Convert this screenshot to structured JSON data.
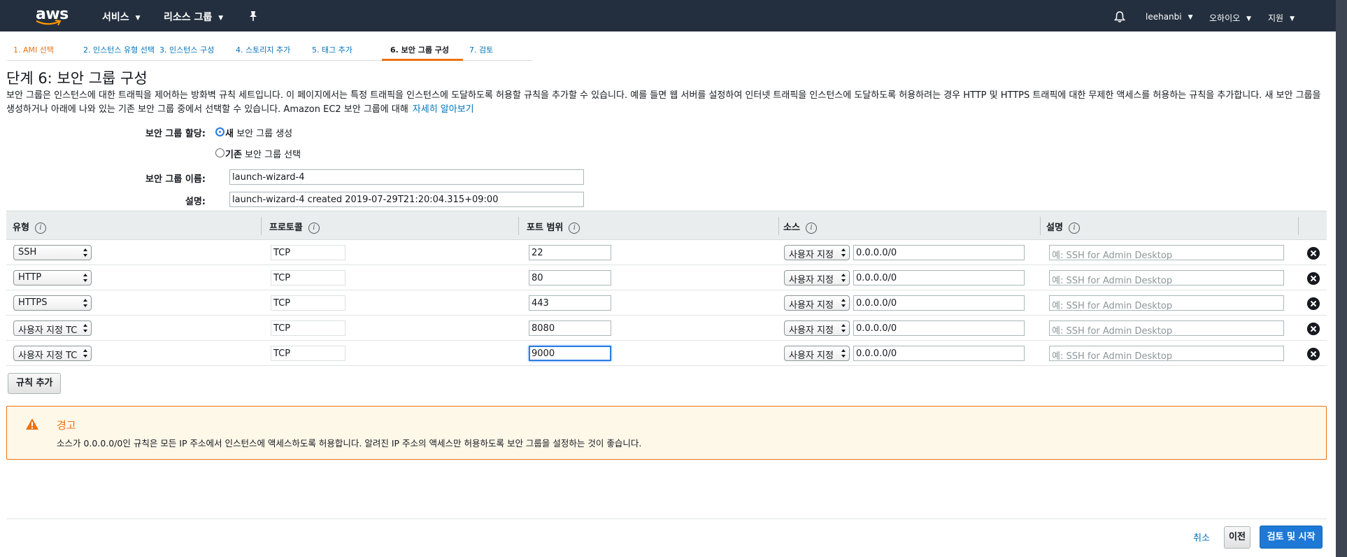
{
  "colors": {
    "nav_bg": "#232f3e",
    "accent": "#ec7211",
    "link": "#0073bb",
    "primary_button": "#1e79d6"
  },
  "topnav": {
    "logo": "aws",
    "services": "서비스",
    "resource_groups": "리소스 그룹",
    "pin_icon": "pin-icon",
    "bell_icon": "bell-icon",
    "user": "leehanbi",
    "region": "오하이오",
    "support": "지원"
  },
  "tabs": [
    {
      "label": "1. AMI 선택",
      "state": "done"
    },
    {
      "label": "2. 인스턴스 유형 선택",
      "state": "link"
    },
    {
      "label": "3. 인스턴스 구성",
      "state": "link"
    },
    {
      "label": "4. 스토리지 추가",
      "state": "link"
    },
    {
      "label": "5. 태그 추가",
      "state": "link"
    },
    {
      "label": "6. 보안 그룹 구성",
      "state": "active"
    },
    {
      "label": "7. 검토",
      "state": "link"
    }
  ],
  "page": {
    "title": "단계 6: 보안 그룹 구성",
    "intro": "보안 그룹은 인스턴스에 대한 트래픽을 제어하는 방화벽 규칙 세트입니다. 이 페이지에서는 특정 트래픽을 인스턴스에 도달하도록 허용할 규칙을 추가할 수 있습니다. 예를 들면 웹 서버를 설정하여 인터넷 트래픽을 인스턴스에 도달하도록 허용하려는 경우 HTTP 및 HTTPS 트래픽에 대한 무제한 액세스를 허용하는 규칙을 추가합니다. 새 보안 그룹을 생성하거나 아래에 나와 있는 기존 보안 그룹 중에서 선택할 수 있습니다. Amazon EC2 보안 그룹에 대해",
    "learn_more": "자세히 알아보기"
  },
  "form": {
    "assign_label": "보안 그룹 할당:",
    "option_new_bold": "새",
    "option_new_rest": " 보안 그룹 생성",
    "option_existing_bold": "기존",
    "option_existing_rest": " 보안 그룹 선택",
    "name_label": "보안 그룹 이름:",
    "name_value": "launch-wizard-4",
    "desc_label": "설명:",
    "desc_value": "launch-wizard-4 created 2019-07-29T21:20:04.315+09:00"
  },
  "table": {
    "headers": {
      "type": "유형",
      "protocol": "프로토콜",
      "port": "포트 범위",
      "source": "소스",
      "description": "설명"
    },
    "rows": [
      {
        "type": "SSH",
        "protocol": "TCP",
        "port": "22",
        "source_type": "사용자 지정",
        "source": "0.0.0.0/0",
        "desc_placeholder": "예: SSH for Admin Desktop"
      },
      {
        "type": "HTTP",
        "protocol": "TCP",
        "port": "80",
        "source_type": "사용자 지정",
        "source": "0.0.0.0/0",
        "desc_placeholder": "예: SSH for Admin Desktop"
      },
      {
        "type": "HTTPS",
        "protocol": "TCP",
        "port": "443",
        "source_type": "사용자 지정",
        "source": "0.0.0.0/0",
        "desc_placeholder": "예: SSH for Admin Desktop"
      },
      {
        "type": "사용자 지정 TC",
        "protocol": "TCP",
        "port": "8080",
        "source_type": "사용자 지정",
        "source": "0.0.0.0/0",
        "desc_placeholder": "예: SSH for Admin Desktop"
      },
      {
        "type": "사용자 지정 TC",
        "protocol": "TCP",
        "port": "9000",
        "source_type": "사용자 지정",
        "source": "0.0.0.0/0",
        "desc_placeholder": "예: SSH for Admin Desktop"
      }
    ],
    "add_rule": "규칙 추가"
  },
  "warning": {
    "title": "경고",
    "text": "소스가 0.0.0.0/0인 규칙은 모든 IP 주소에서 인스턴스에 액세스하도록 허용합니다. 알려진 IP 주소의 액세스만 허용하도록 보안 그룹을 설정하는 것이 좋습니다."
  },
  "footer": {
    "cancel": "취소",
    "previous": "이전",
    "review_launch": "검토 및 시작"
  }
}
